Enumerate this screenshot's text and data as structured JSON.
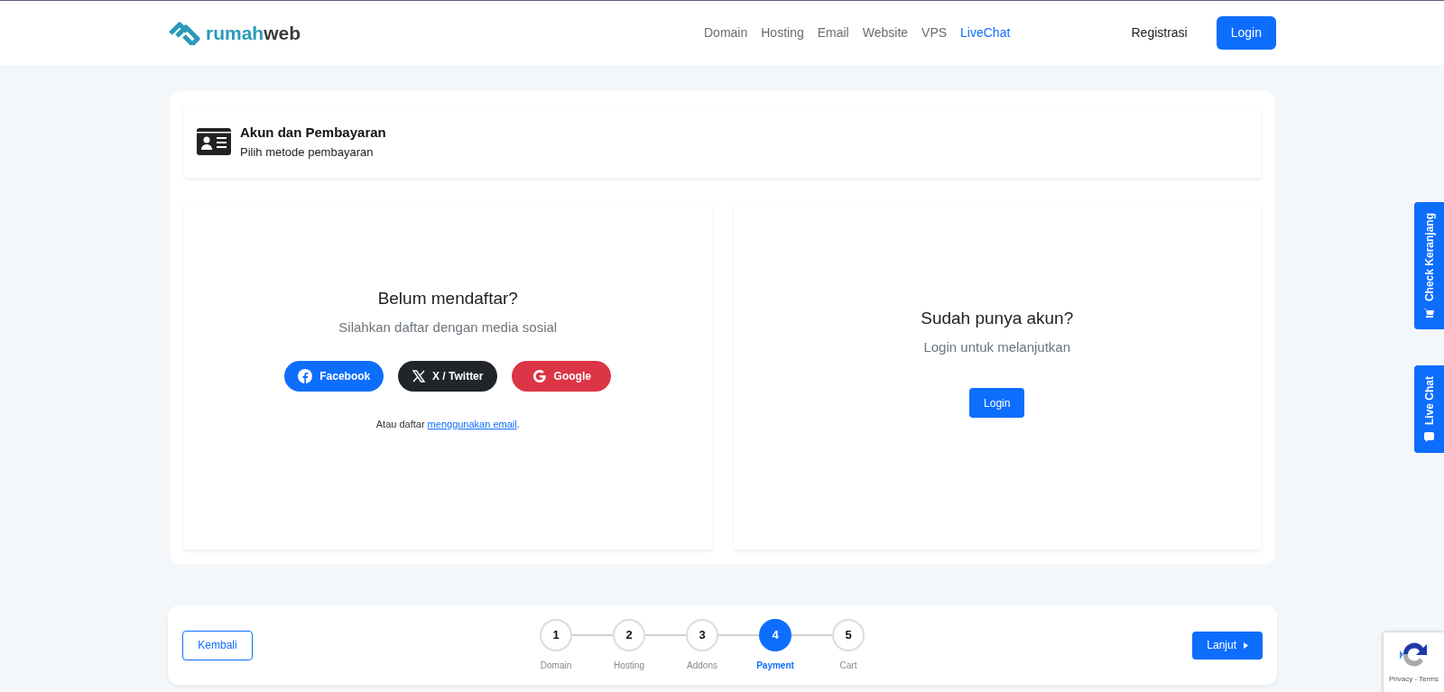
{
  "header": {
    "logo": {
      "part1": "rumah",
      "part2": "web"
    },
    "nav": [
      {
        "label": "Domain",
        "selected": false
      },
      {
        "label": "Hosting",
        "selected": false
      },
      {
        "label": "Email",
        "selected": false
      },
      {
        "label": "Website",
        "selected": false
      },
      {
        "label": "VPS",
        "selected": false
      },
      {
        "label": "LiveChat",
        "selected": true
      }
    ],
    "register": "Registrasi",
    "login": "Login"
  },
  "section": {
    "title": "Akun dan Pembayaran",
    "subtitle": "Pilih metode pembayaran"
  },
  "signup": {
    "title": "Belum mendaftar?",
    "subtitle": "Silahkan daftar dengan media sosial",
    "socials": [
      {
        "kind": "facebook",
        "label": "Facebook"
      },
      {
        "kind": "twitter",
        "label": "X / Twitter"
      },
      {
        "kind": "google",
        "label": "Google"
      }
    ],
    "email_prefix": "Atau daftar ",
    "email_link": "menggunakan email",
    "email_suffix": "."
  },
  "signin": {
    "title": "Sudah punya akun?",
    "subtitle": "Login untuk melanjutkan",
    "button": "Login"
  },
  "side_tabs": [
    {
      "kind": "cart",
      "label": "Check Keranjang"
    },
    {
      "kind": "chat",
      "label": "Live Chat"
    }
  ],
  "steps": {
    "back": "Kembali",
    "next": "Lanjut",
    "items": [
      {
        "number": "1",
        "label": "Domain",
        "selected": false
      },
      {
        "number": "2",
        "label": "Hosting",
        "selected": false
      },
      {
        "number": "3",
        "label": "Addons",
        "selected": false
      },
      {
        "number": "4",
        "label": "Payment",
        "selected": true
      },
      {
        "number": "5",
        "label": "Cart",
        "selected": false
      }
    ]
  },
  "recaptcha": {
    "text": "Privacy - Terms"
  }
}
